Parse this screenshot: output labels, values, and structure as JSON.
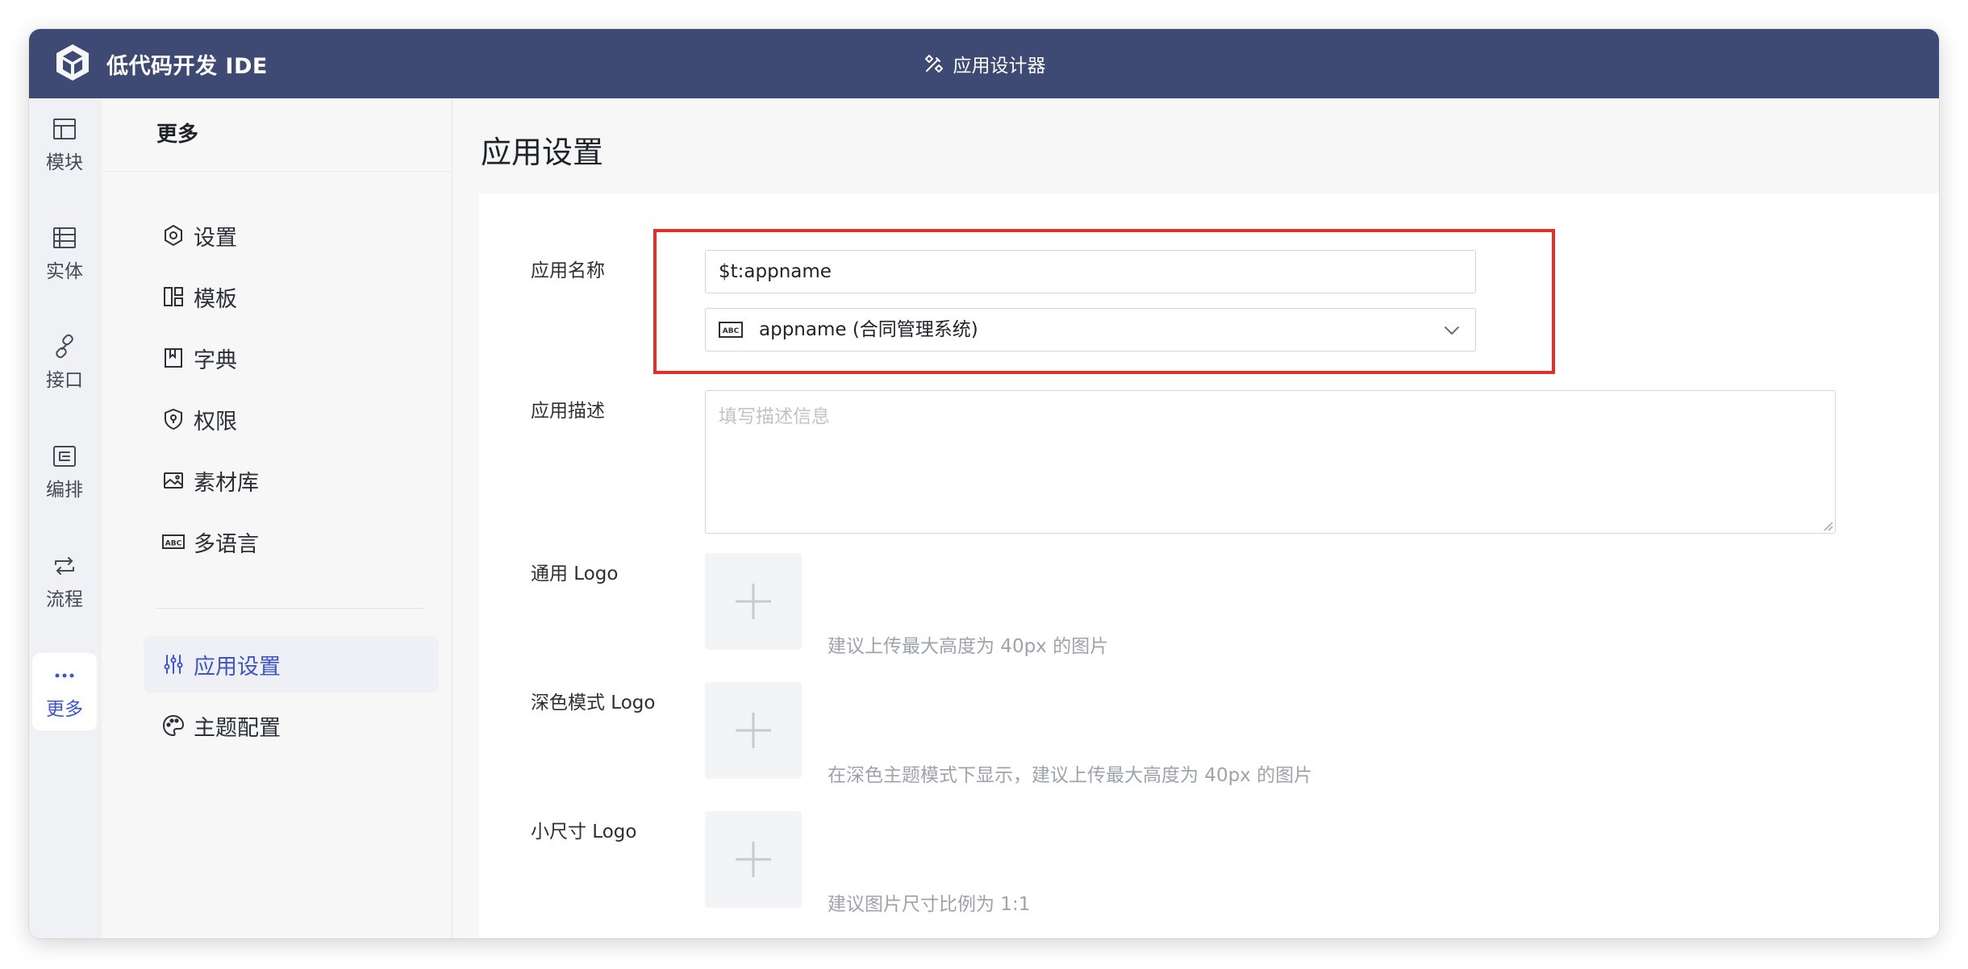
{
  "app": {
    "brand_title": "低代码开发 IDE",
    "center_title": "应用设计器"
  },
  "rail": {
    "items": [
      {
        "label": "模块",
        "icon": "layout-icon"
      },
      {
        "label": "实体",
        "icon": "table-icon"
      },
      {
        "label": "接口",
        "icon": "link-icon"
      },
      {
        "label": "编排",
        "icon": "orchestrate-icon"
      },
      {
        "label": "流程",
        "icon": "loop-icon"
      },
      {
        "label": "更多",
        "icon": "more-icon",
        "active": true
      }
    ]
  },
  "panel": {
    "title": "更多",
    "items": [
      {
        "label": "设置",
        "icon": "settings-icon"
      },
      {
        "label": "模板",
        "icon": "template-icon"
      },
      {
        "label": "字典",
        "icon": "bookmark-icon"
      },
      {
        "label": "权限",
        "icon": "shield-icon"
      },
      {
        "label": "素材库",
        "icon": "image-icon"
      },
      {
        "label": "多语言",
        "icon": "abc-icon"
      },
      {
        "label": "应用设置",
        "icon": "sliders-icon",
        "active": true
      },
      {
        "label": "主题配置",
        "icon": "palette-icon"
      }
    ]
  },
  "main": {
    "page_title": "应用设置",
    "form": {
      "app_name": {
        "label": "应用名称",
        "value": "$t:appname",
        "i18n_select_value": "appname (合同管理系统)"
      },
      "app_desc": {
        "label": "应用描述",
        "placeholder": "填写描述信息"
      },
      "logo_general": {
        "label": "通用 Logo",
        "hint": "建议上传最大高度为 40px 的图片"
      },
      "logo_dark": {
        "label": "深色模式 Logo",
        "hint": "在深色主题模式下显示，建议上传最大高度为 40px 的图片"
      },
      "logo_small": {
        "label": "小尺寸 Logo",
        "hint": "建议图片尺寸比例为 1:1"
      }
    }
  },
  "colors": {
    "topbar": "#3e4a74",
    "accent": "#3c55d0",
    "highlight": "#e0302a"
  }
}
